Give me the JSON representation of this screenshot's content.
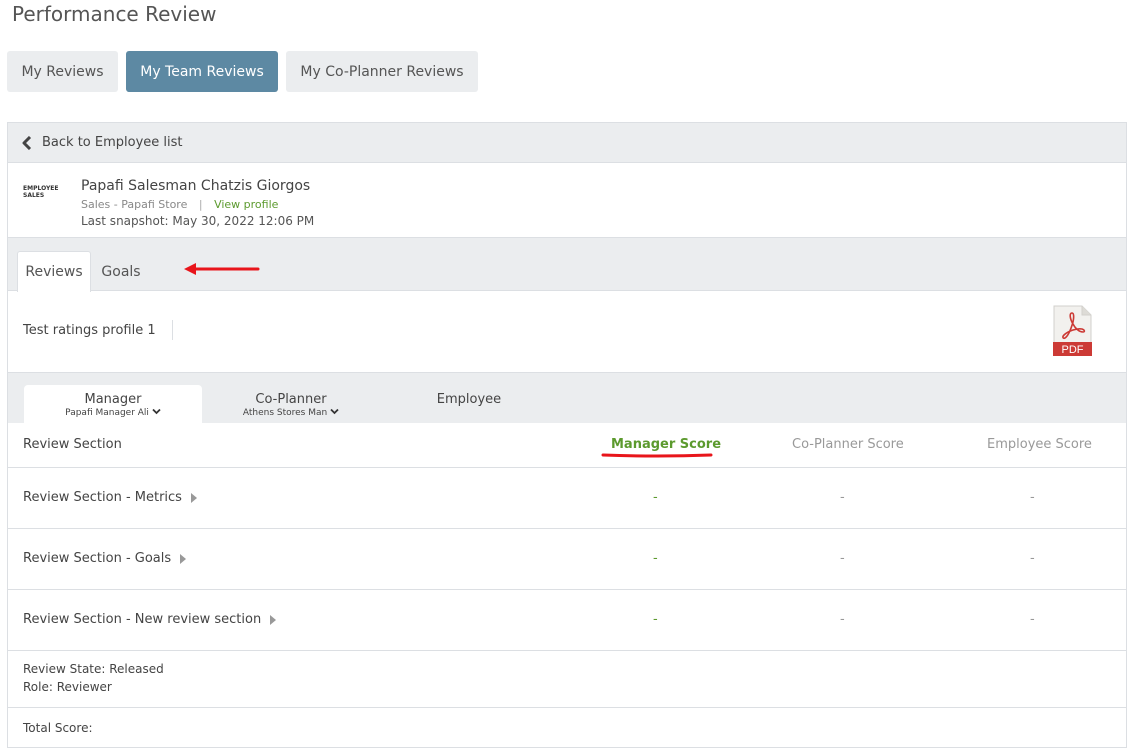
{
  "page": {
    "title": "Performance Review"
  },
  "top_tabs": [
    {
      "label": "My Reviews",
      "active": false
    },
    {
      "label": "My Team Reviews",
      "active": true
    },
    {
      "label": "My Co-Planner Reviews",
      "active": false
    }
  ],
  "back": {
    "label": "Back to Employee list"
  },
  "employee": {
    "logo_text_line1": "EMPLOYEE",
    "logo_text_line2": "SALES",
    "name": "Papafi Salesman Chatzis Giorgos",
    "department": "Sales - Papafi Store",
    "separator": "|",
    "view_profile": "View profile",
    "last_snapshot": "Last snapshot: May 30, 2022 12:06 PM"
  },
  "sub_tabs": [
    {
      "label": "Reviews",
      "active": true
    },
    {
      "label": "Goals",
      "active": false
    }
  ],
  "profile": {
    "name": "Test ratings profile 1",
    "pdf_label": "PDF",
    "pdf_icon": "pdf-file-icon"
  },
  "reviewer_tabs": [
    {
      "label": "Manager",
      "sub": "Papafi Manager Ali",
      "active": true
    },
    {
      "label": "Co-Planner",
      "sub": "Athens Stores Man",
      "active": false
    },
    {
      "label": "Employee",
      "sub": "",
      "active": false
    }
  ],
  "table": {
    "headers": {
      "section": "Review Section",
      "manager": "Manager Score",
      "coplanner": "Co-Planner Score",
      "employee": "Employee Score"
    },
    "rows": [
      {
        "section": "Review Section - Metrics",
        "manager": "-",
        "coplanner": "-",
        "employee": "-"
      },
      {
        "section": "Review Section - Goals",
        "manager": "-",
        "coplanner": "-",
        "employee": "-"
      },
      {
        "section": "Review Section - New review section",
        "manager": "-",
        "coplanner": "-",
        "employee": "-"
      }
    ]
  },
  "status": {
    "review_state": "Review State: Released",
    "role": "Role: Reviewer",
    "total_score": "Total Score:"
  },
  "colors": {
    "accent_active_tab": "#5d89a3",
    "score_green": "#5c9a2e",
    "annotation_red": "#e8151b"
  }
}
